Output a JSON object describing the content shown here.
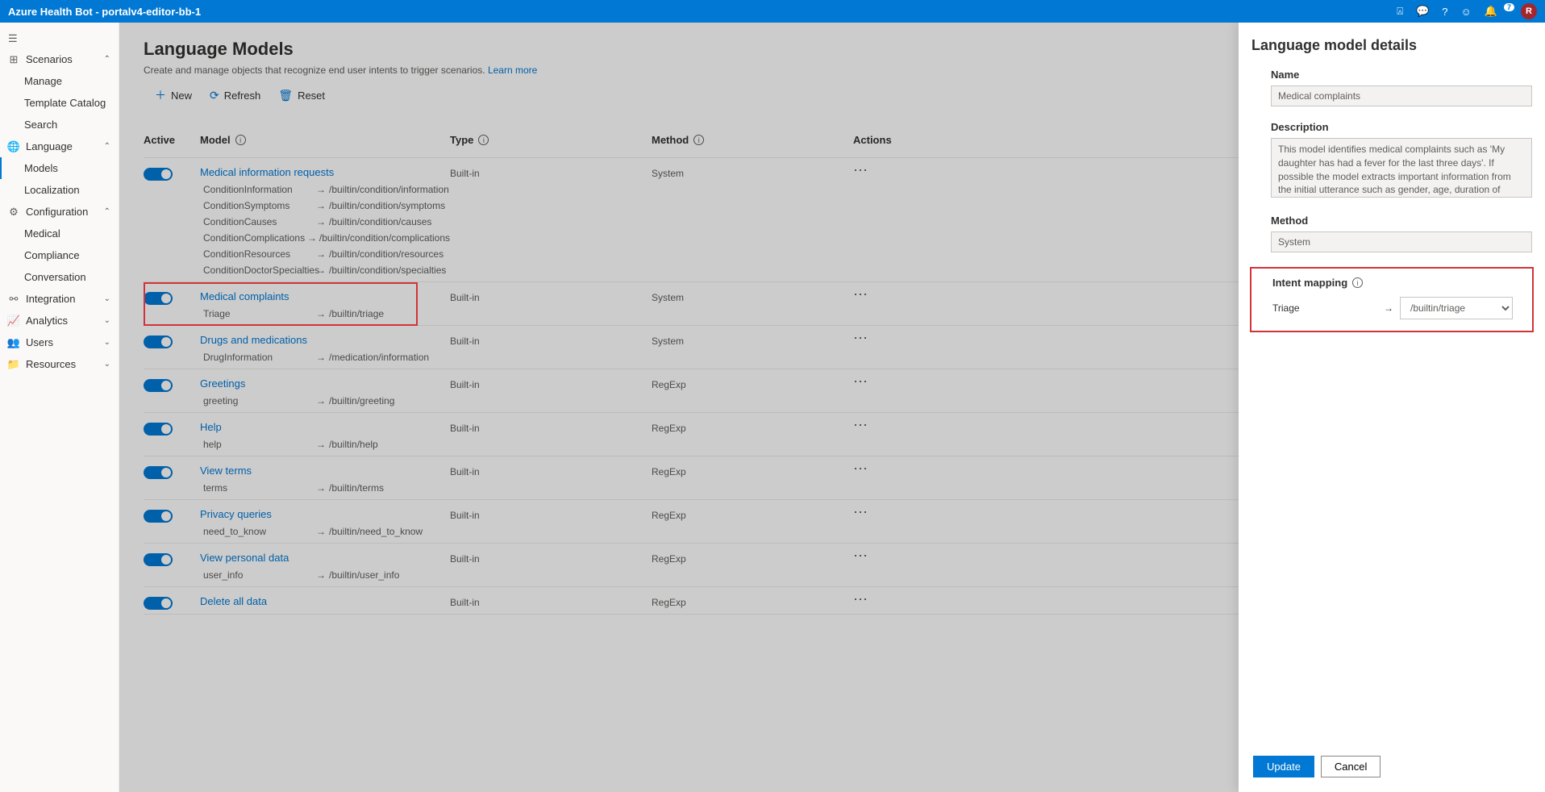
{
  "header": {
    "title": "Azure Health Bot - portalv4-editor-bb-1",
    "notification_count": "7",
    "avatar_initial": "R"
  },
  "sidebar": {
    "groups": [
      {
        "label": "Scenarios",
        "icon": "scenarios",
        "expanded": true,
        "items": [
          {
            "label": "Manage"
          },
          {
            "label": "Template Catalog"
          },
          {
            "label": "Search"
          }
        ]
      },
      {
        "label": "Language",
        "icon": "language",
        "expanded": true,
        "items": [
          {
            "label": "Models",
            "active": true
          },
          {
            "label": "Localization"
          }
        ]
      },
      {
        "label": "Configuration",
        "icon": "gear",
        "expanded": true,
        "items": [
          {
            "label": "Medical"
          },
          {
            "label": "Compliance"
          },
          {
            "label": "Conversation"
          }
        ]
      },
      {
        "label": "Integration",
        "icon": "integration",
        "expanded": false
      },
      {
        "label": "Analytics",
        "icon": "analytics",
        "expanded": false
      },
      {
        "label": "Users",
        "icon": "users",
        "expanded": false
      },
      {
        "label": "Resources",
        "icon": "folder",
        "expanded": false
      }
    ]
  },
  "page": {
    "title": "Language Models",
    "description": "Create and manage objects that recognize end user intents to trigger scenarios.",
    "learn_more": "Learn more"
  },
  "toolbar": {
    "new": "New",
    "refresh": "Refresh",
    "reset": "Reset"
  },
  "columns": {
    "active": "Active",
    "model": "Model",
    "type": "Type",
    "method": "Method",
    "actions": "Actions"
  },
  "models": [
    {
      "name": "Medical information requests",
      "type": "Built-in",
      "method": "System",
      "intents": [
        {
          "name": "ConditionInformation",
          "path": "/builtin/condition/information"
        },
        {
          "name": "ConditionSymptoms",
          "path": "/builtin/condition/symptoms"
        },
        {
          "name": "ConditionCauses",
          "path": "/builtin/condition/causes"
        },
        {
          "name": "ConditionComplications",
          "path": "/builtin/condition/complications"
        },
        {
          "name": "ConditionResources",
          "path": "/builtin/condition/resources"
        },
        {
          "name": "ConditionDoctorSpecialties",
          "path": "/builtin/condition/specialties"
        }
      ],
      "highlight": false
    },
    {
      "name": "Medical complaints",
      "type": "Built-in",
      "method": "System",
      "intents": [
        {
          "name": "Triage",
          "path": "/builtin/triage"
        }
      ],
      "highlight": true
    },
    {
      "name": "Drugs and medications",
      "type": "Built-in",
      "method": "System",
      "intents": [
        {
          "name": "DrugInformation",
          "path": "/medication/information"
        }
      ]
    },
    {
      "name": "Greetings",
      "type": "Built-in",
      "method": "RegExp",
      "intents": [
        {
          "name": "greeting",
          "path": "/builtin/greeting"
        }
      ]
    },
    {
      "name": "Help",
      "type": "Built-in",
      "method": "RegExp",
      "intents": [
        {
          "name": "help",
          "path": "/builtin/help"
        }
      ]
    },
    {
      "name": "View terms",
      "type": "Built-in",
      "method": "RegExp",
      "intents": [
        {
          "name": "terms",
          "path": "/builtin/terms"
        }
      ]
    },
    {
      "name": "Privacy queries",
      "type": "Built-in",
      "method": "RegExp",
      "intents": [
        {
          "name": "need_to_know",
          "path": "/builtin/need_to_know"
        }
      ]
    },
    {
      "name": "View personal data",
      "type": "Built-in",
      "method": "RegExp",
      "intents": [
        {
          "name": "user_info",
          "path": "/builtin/user_info"
        }
      ]
    },
    {
      "name": "Delete all data",
      "type": "Built-in",
      "method": "RegExp",
      "intents": []
    }
  ],
  "panel": {
    "title": "Language model details",
    "name_label": "Name",
    "name_value": "Medical complaints",
    "desc_label": "Description",
    "desc_value": "This model identifies medical complaints such as 'My daughter has had a fever for the last three days'. If possible the model extracts important information from the initial utterance such as gender, age, duration of symptoms and the subject of the complaint.",
    "method_label": "Method",
    "method_value": "System",
    "mapping_label": "Intent mapping",
    "mapping_intent": "Triage",
    "mapping_value": "/builtin/triage",
    "update": "Update",
    "cancel": "Cancel"
  }
}
